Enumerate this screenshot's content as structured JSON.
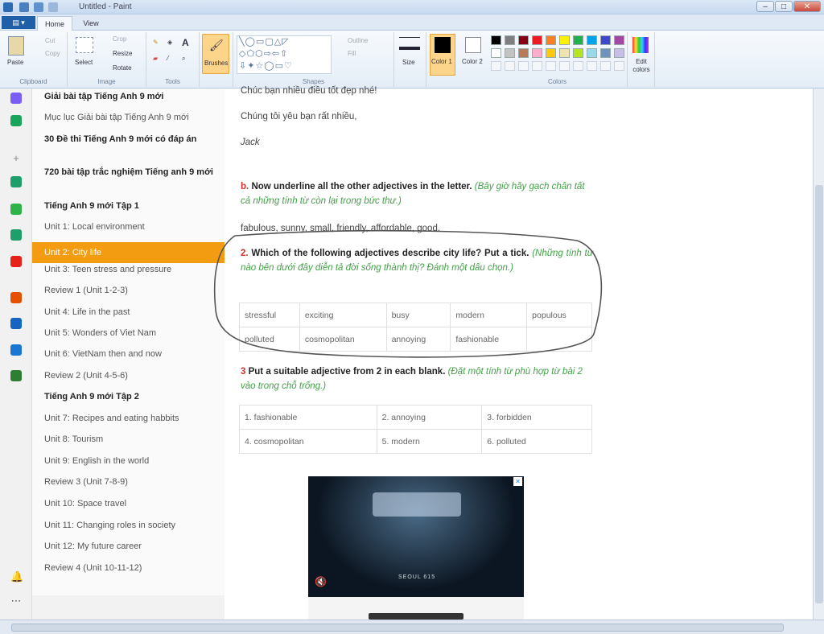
{
  "window": {
    "title": "Untitled - Paint"
  },
  "ribbon": {
    "tabs": [
      "Home",
      "View"
    ],
    "clipboard": {
      "paste": "Paste",
      "cut": "Cut",
      "copy": "Copy",
      "label": "Clipboard"
    },
    "image": {
      "select": "Select",
      "crop": "Crop",
      "resize": "Resize",
      "rotate": "Rotate",
      "label": "Image"
    },
    "tools": {
      "label": "Tools"
    },
    "brushes": "Brushes",
    "shapes": {
      "outline": "Outline",
      "fill": "Fill",
      "label": "Shapes"
    },
    "size": "Size",
    "color1": "Color 1",
    "color2": "Color 2",
    "colors_label": "Colors",
    "edit_colors": "Edit colors",
    "palette": [
      "#000000",
      "#7f7f7f",
      "#880015",
      "#ed1c24",
      "#ff7f27",
      "#fff200",
      "#22b14c",
      "#00a2e8",
      "#3f48cc",
      "#a349a4",
      "#ffffff",
      "#c3c3c3",
      "#b97a57",
      "#ffaec9",
      "#ffc90e",
      "#efe4b0",
      "#b5e61d",
      "#99d9ea",
      "#7092be",
      "#c8bfe7"
    ]
  },
  "rail_icons": [
    "messenger-icon",
    "game-icon",
    "plus-icon",
    "app-icon",
    "app-icon",
    "app-icon",
    "youtube-icon",
    "app-icon",
    "vtv-icon",
    "app-icon",
    "app-icon",
    "bell-icon",
    "more-icon"
  ],
  "sidebar": {
    "items": [
      {
        "label": "Giải bài tập Tiếng Anh 9 mới",
        "style": "bold"
      },
      {
        "label": "Mục lục Giải bài tập Tiếng Anh 9 mới",
        "style": "normal"
      },
      {
        "label": "30 Đề thi Tiếng Anh 9 mới có đáp án",
        "style": "bold"
      },
      {
        "label": "720 bài tập trắc nghiệm Tiếng anh 9 mới",
        "style": "bold"
      },
      {
        "label": "Tiếng Anh 9 mới Tập 1",
        "style": "bold"
      },
      {
        "label": "Unit 1: Local environment",
        "style": "normal"
      },
      {
        "label": "Unit 2: City life",
        "style": "active"
      },
      {
        "label": "Unit 3: Teen stress and pressure",
        "style": "normal"
      },
      {
        "label": "Review 1 (Unit 1-2-3)",
        "style": "normal"
      },
      {
        "label": "Unit 4: Life in the past",
        "style": "normal"
      },
      {
        "label": "Unit 5: Wonders of Viet Nam",
        "style": "normal"
      },
      {
        "label": "Unit 6: VietNam then and now",
        "style": "normal"
      },
      {
        "label": "Review 2 (Unit 4-5-6)",
        "style": "normal"
      },
      {
        "label": "Tiếng Anh 9 mới Tập 2",
        "style": "bold"
      },
      {
        "label": "Unit 7: Recipes and eating habbits",
        "style": "normal"
      },
      {
        "label": "Unit 8: Tourism",
        "style": "normal"
      },
      {
        "label": "Unit 9: English in the world",
        "style": "normal"
      },
      {
        "label": "Review 3 (Unit 7-8-9)",
        "style": "normal"
      },
      {
        "label": "Unit 10: Space travel",
        "style": "normal"
      },
      {
        "label": "Unit 11: Changing roles in society",
        "style": "normal"
      },
      {
        "label": "Unit 12: My future career",
        "style": "normal"
      },
      {
        "label": "Review 4 (Unit 10-11-12)",
        "style": "normal"
      }
    ]
  },
  "content": {
    "top_line": "Chúc bạn nhiều điều tốt đẹp nhé!",
    "love_line": "Chúng tôi yêu bạn rất nhiều,",
    "signature": "Jack",
    "qb": {
      "num": "b.",
      "en": "Now underline all the other adjectives in the letter.",
      "vi": "(Bây giờ hãy gạch chân tất cả những tính từ còn lại trong bức thư.)"
    },
    "answer_b": "fabulous, sunny, small, friendly, affordable, good.",
    "q2": {
      "num": "2.",
      "en": "Which of the following adjectives describe city life? Put a tick.",
      "vi": "(Những tính từ nào bên dưới đây diễn tả đời sống thành thị? Đánh một dấu chọn.)"
    },
    "table2": [
      [
        "stressful",
        "exciting",
        "busy",
        "modern",
        "populous"
      ],
      [
        "polluted",
        "cosmopolitan",
        "annoying",
        "fashionable",
        ""
      ]
    ],
    "q3": {
      "num": "3",
      "en": "Put a suitable adjective from 2 in each blank.",
      "vi": "(Đặt một tính từ phù hợp từ bài 2 vào trong chỗ trống.)"
    },
    "table3": [
      [
        "1. fashionable",
        "2. annoying",
        "3. forbidden"
      ],
      [
        "4. cosmopolitan",
        "5. modern",
        "6. polluted"
      ]
    ],
    "ad": {
      "close": "✕",
      "caption": "SEOUL 615"
    }
  }
}
